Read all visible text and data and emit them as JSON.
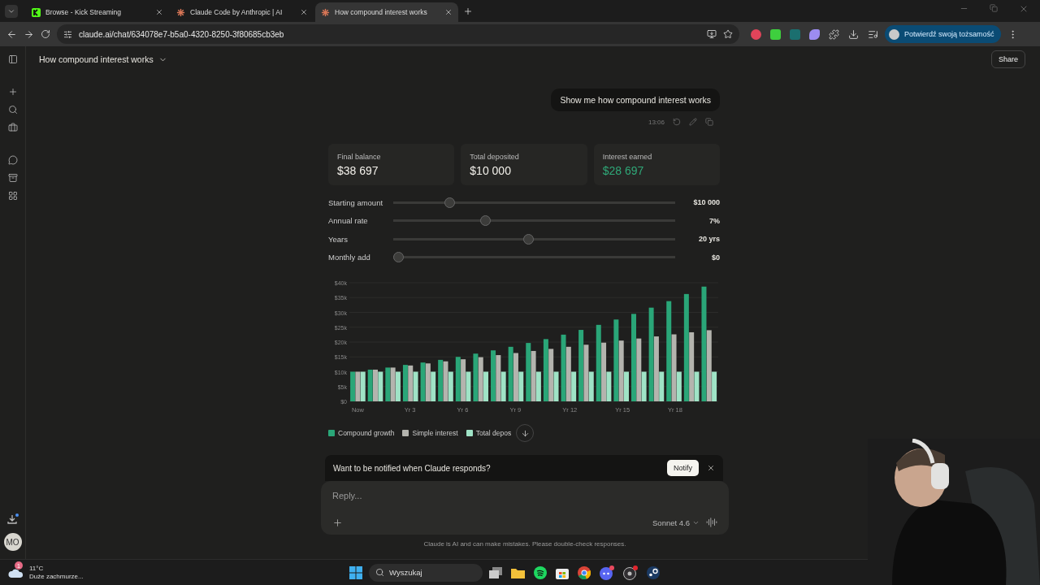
{
  "browser": {
    "tabs": [
      {
        "title": "Browse - Kick Streaming",
        "selected": false
      },
      {
        "title": "Claude Code by Anthropic | AI",
        "selected": false
      },
      {
        "title": "How compound interest works",
        "selected": true
      }
    ],
    "url": "claude.ai/chat/634078e7-b5a0-4320-8250-3f80685cb3eb",
    "profile_button": "Potwierdź swoją tożsamość"
  },
  "sidebar": {
    "avatar": "MO"
  },
  "header": {
    "title": "How compound interest works",
    "share": "Share"
  },
  "message": {
    "text": "Show me how compound interest works",
    "time": "13:06"
  },
  "stats": [
    {
      "label": "Final balance",
      "value": "$38 697",
      "accent": false
    },
    {
      "label": "Total deposited",
      "value": "$10 000",
      "accent": false
    },
    {
      "label": "Interest earned",
      "value": "$28 697",
      "accent": true
    }
  ],
  "sliders": [
    {
      "label": "Starting amount",
      "level": 0.19,
      "reading": "$10 000"
    },
    {
      "label": "Annual rate",
      "level": 0.32,
      "reading": "7%"
    },
    {
      "label": "Years",
      "level": 0.48,
      "reading": "20 yrs"
    },
    {
      "label": "Monthly add",
      "level": 0,
      "reading": "$0"
    }
  ],
  "chart_data": {
    "type": "bar",
    "stacked": false,
    "grid": true,
    "categories": [
      "Now",
      null,
      null,
      "Yr 3",
      null,
      null,
      "Yr 6",
      null,
      null,
      "Yr 9",
      null,
      null,
      "Yr 12",
      null,
      null,
      "Yr 15",
      null,
      null,
      "Yr 18",
      null,
      null
    ],
    "ylim": [
      0,
      40000
    ],
    "yticks": [
      {
        "value": 0,
        "label": "$0"
      },
      {
        "value": 5000,
        "label": "$5k"
      },
      {
        "value": 10000,
        "label": "$10k"
      },
      {
        "value": 15000,
        "label": "$15k"
      },
      {
        "value": 20000,
        "label": "$20k"
      },
      {
        "value": 25000,
        "label": "$25k"
      },
      {
        "value": 30000,
        "label": "$30k"
      },
      {
        "value": 35000,
        "label": "$35k"
      },
      {
        "value": 40000,
        "label": "$40k"
      }
    ],
    "series": [
      {
        "name": "Compound growth",
        "color": "#2aa678",
        "values": [
          10000,
          10700,
          11400,
          12300,
          13100,
          14000,
          15000,
          16100,
          17200,
          18400,
          19700,
          21000,
          22500,
          24100,
          25800,
          27600,
          29500,
          31600,
          33800,
          36200,
          38700
        ]
      },
      {
        "name": "Simple interest",
        "color": "#b4b4ae",
        "values": [
          10000,
          10700,
          11400,
          12100,
          12800,
          13500,
          14200,
          14900,
          15600,
          16300,
          17000,
          17700,
          18400,
          19100,
          19800,
          20500,
          21200,
          21900,
          22600,
          23300,
          24000
        ]
      },
      {
        "name": "Total depos",
        "color": "#9fe3c6",
        "values": [
          10000,
          10000,
          10000,
          10000,
          10000,
          10000,
          10000,
          10000,
          10000,
          10000,
          10000,
          10000,
          10000,
          10000,
          10000,
          10000,
          10000,
          10000,
          10000,
          10000,
          10000
        ]
      }
    ]
  },
  "notice": {
    "text": "Want to be notified when Claude responds?",
    "button": "Notify"
  },
  "composer": {
    "placeholder": "Reply...",
    "model": "Sonnet 4.6"
  },
  "disclaimer": "Claude is AI and can make mistakes. Please double-check responses.",
  "taskbar": {
    "weather_badge": "1",
    "temperature": "11°C",
    "weather": "Duże zachmurze...",
    "search_placeholder": "Wyszukaj"
  }
}
